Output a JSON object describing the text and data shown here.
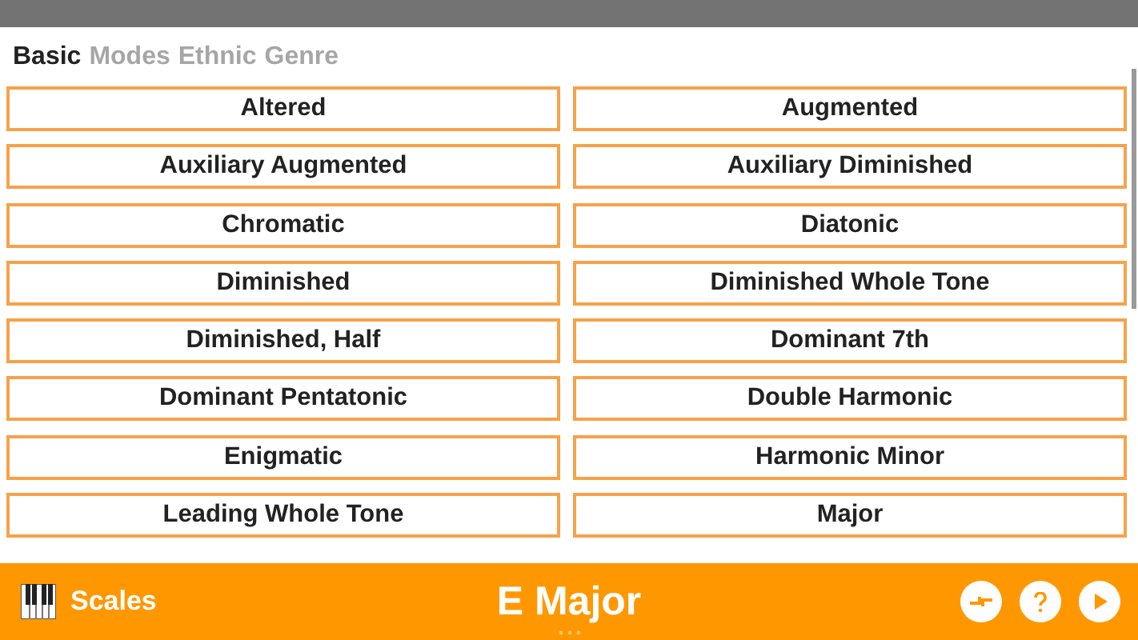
{
  "tabs": [
    {
      "label": "Basic",
      "selected": true
    },
    {
      "label": "Modes",
      "selected": false
    },
    {
      "label": "Ethnic",
      "selected": false
    },
    {
      "label": "Genre",
      "selected": false
    }
  ],
  "scales": [
    "Altered",
    "Augmented",
    "Auxiliary Augmented",
    "Auxiliary Diminished",
    "Chromatic",
    "Diatonic",
    "Diminished",
    "Diminished Whole Tone",
    "Diminished, Half",
    "Dominant 7th",
    "Dominant Pentatonic",
    "Double Harmonic",
    "Enigmatic",
    "Harmonic Minor",
    "Leading Whole Tone",
    "Major"
  ],
  "bottom_bar": {
    "section": "Scales",
    "title": "E Major"
  }
}
